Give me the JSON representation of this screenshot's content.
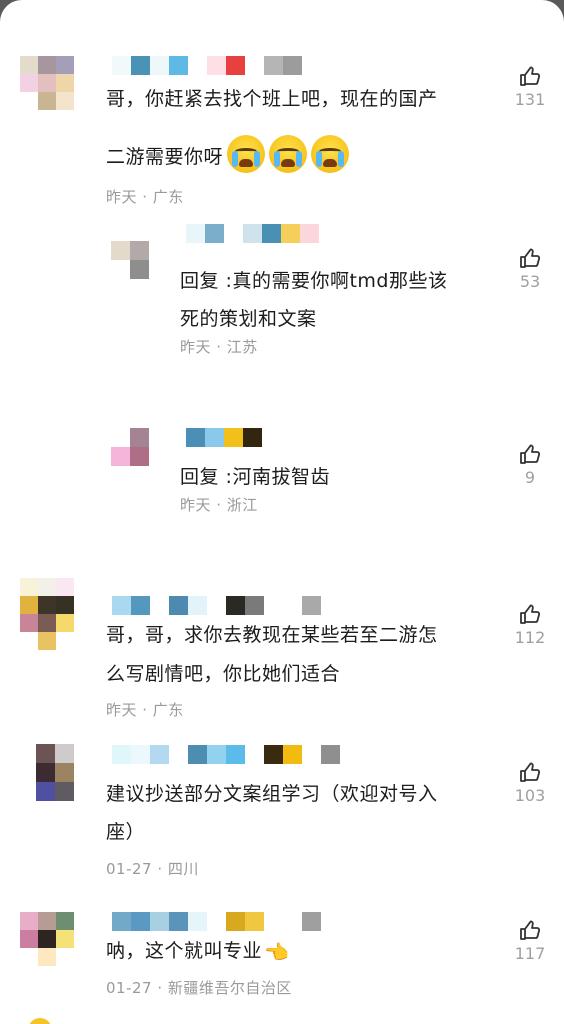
{
  "comments": [
    {
      "text_line1": "哥，你赶紧去找个班上吧，现在的国产",
      "text_line2": "二游需要你呀",
      "emoji": "loudly-crying-face",
      "meta": "昨天 · 广东",
      "likes": "131",
      "avatar_colors": [
        "#e4dccb",
        "#a8969e",
        "#a59eb8",
        "#f2d2e2",
        "#e3bfbf",
        "#eed6aa",
        "#ffffff",
        "#c9b494",
        "#f5e4cc"
      ],
      "name_colors": [
        "#f1f9fb",
        "#4b92b7",
        "#eef8fb",
        "#5fb9e7",
        "#ffffff",
        "#fde0e5",
        "#e8403f",
        "#ffffff",
        "#b5b5b5",
        "#9c9c9c"
      ]
    },
    {
      "text_line1": "回复 :真的需要你啊tmd那些该",
      "text_line2": "死的策划和文案",
      "meta": "昨天 · 江苏",
      "likes": "53",
      "avatar_colors": [
        "#e3dacb",
        "#b3a9a9",
        "#ffffff",
        "#8e8e8e"
      ],
      "name_colors": [
        "#e8f6fa",
        "#7aaec9",
        "#ffffff",
        "#cfe3ec",
        "#4a8fb4",
        "#f4cf5a",
        "#fbd7dc"
      ]
    },
    {
      "text_line1": "回复 :河南拔智齿",
      "meta": "昨天 · 浙江",
      "likes": "9",
      "avatar_colors": [
        "#ffffff",
        "#a48493",
        "#f5b4d9",
        "#b06d86"
      ],
      "name_colors": [
        "#4b8fb6",
        "#8ac9eb",
        "#f1c01a",
        "#332611"
      ]
    },
    {
      "text_line1": "哥，哥，求你去教现在某些若至二游怎",
      "text_line2": "么写剧情吧，你比她们适合",
      "meta": "昨天 · 广东",
      "likes": "112",
      "avatar_colors": [
        "#f8f3d8",
        "#f3efe9",
        "#fbe7f1",
        "#e2b23e",
        "#3d3527",
        "#363125",
        "#c88597",
        "#7a5c55",
        "#f5d96a",
        "#ffffff",
        "#e9c264",
        "#ffffff"
      ],
      "name_colors": [
        "#a9d9f0",
        "#5498be",
        "#ffffff",
        "#4e8ab0",
        "#e3f3fa",
        "#ffffff",
        "#2b2923",
        "#7a7a7a",
        "#ffffff",
        "#ffffff",
        "#a9a9a9"
      ]
    },
    {
      "text_line1": "建议抄送部分文案组学习（欢迎对号入",
      "text_line2": "座）",
      "meta": "01-27 · 四川",
      "likes": "103",
      "avatar_colors": [
        "#6b5453",
        "#cfcbcd",
        "#3b2c33",
        "#9c8463",
        "#5050a2",
        "#605a62"
      ],
      "name_colors": [
        "#dff7fb",
        "#ecf8fb",
        "#b2d9ef",
        "#ffffff",
        "#4d8db2",
        "#92d1ef",
        "#5bbcea",
        "#ffffff",
        "#3a2a10",
        "#f1bb10",
        "#ffffff",
        "#8f8f8f"
      ]
    },
    {
      "text_line1": "呐，这个就叫专业",
      "emoji": "backhand-index-pointing-left",
      "meta": "01-27 · 新疆维吾尔自治区",
      "likes": "117",
      "avatar_colors": [
        "#e8aec8",
        "#b79c95",
        "#6e8e72",
        "#cc7ea0",
        "#2e2421",
        "#f4e279",
        "#ffffff",
        "#fde8c0",
        "#ffffff"
      ],
      "name_colors": [
        "#72a8c8",
        "#5a9ac2",
        "#a8d0e3",
        "#5b94bb",
        "#e5f6fb",
        "#ffffff",
        "#d8a81f",
        "#f1c742",
        "#ffffff",
        "#ffffff",
        "#9f9f9f"
      ]
    }
  ],
  "icons": {
    "like": "thumbs-up-outline-icon"
  }
}
